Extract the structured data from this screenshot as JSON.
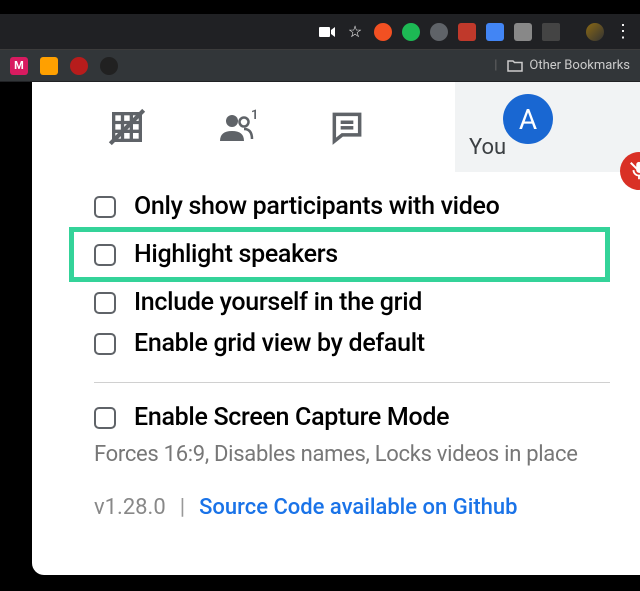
{
  "browser": {
    "other_bookmarks": "Other Bookmarks"
  },
  "self_tile": {
    "label": "You",
    "initial": "A"
  },
  "options": {
    "only_video": "Only show participants with video",
    "highlight_speakers": "Highlight speakers",
    "include_yourself": "Include yourself in the grid",
    "default_grid": "Enable grid view by default",
    "screen_capture": "Enable Screen Capture Mode",
    "screen_capture_desc": "Forces 16:9, Disables names, Locks videos in place"
  },
  "footer": {
    "version": "v1.28.0",
    "link": "Source Code available on Github"
  }
}
